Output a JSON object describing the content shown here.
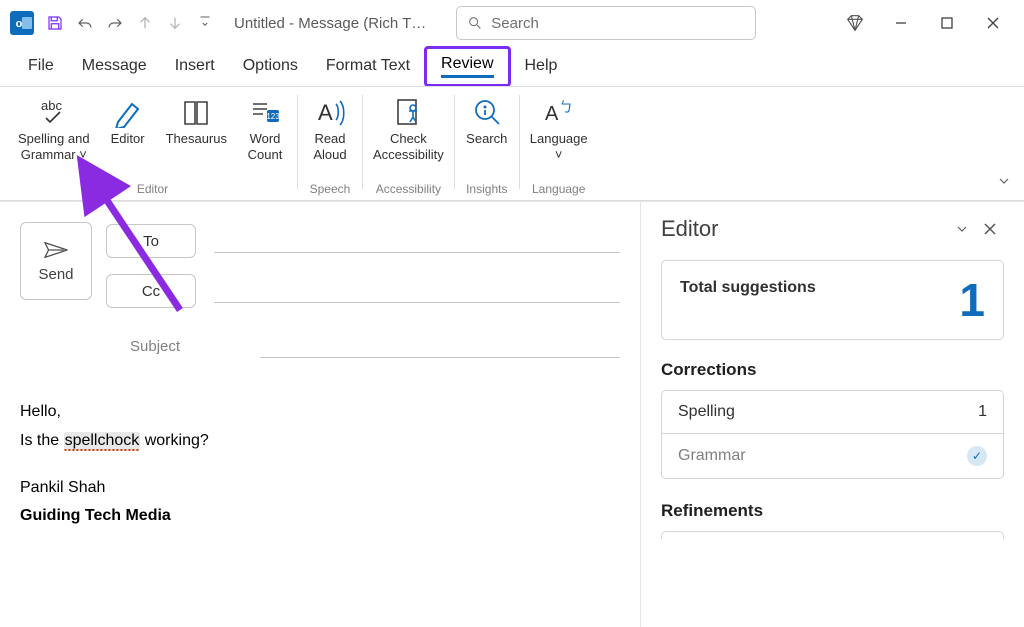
{
  "title": "Untitled - Message (Rich T…",
  "search_placeholder": "Search",
  "menu": [
    "File",
    "Message",
    "Insert",
    "Options",
    "Format Text",
    "Review",
    "Help"
  ],
  "active_menu_index": 5,
  "ribbon": {
    "groups": [
      {
        "label": "Editor",
        "buttons": [
          {
            "label": "Spelling and\nGrammar ˅",
            "icon": "abc-check"
          },
          {
            "label": "Editor",
            "icon": "pen"
          },
          {
            "label": "Thesaurus",
            "icon": "book"
          },
          {
            "label": "Word\nCount",
            "icon": "count"
          }
        ]
      },
      {
        "label": "Speech",
        "buttons": [
          {
            "label": "Read\nAloud",
            "icon": "read-aloud"
          }
        ]
      },
      {
        "label": "Accessibility",
        "buttons": [
          {
            "label": "Check\nAccessibility",
            "icon": "accessibility"
          }
        ]
      },
      {
        "label": "Insights",
        "buttons": [
          {
            "label": "Search",
            "icon": "insight-search"
          }
        ]
      },
      {
        "label": "Language",
        "buttons": [
          {
            "label": "Language\n˅",
            "icon": "language"
          }
        ]
      }
    ]
  },
  "compose": {
    "send": "Send",
    "to": "To",
    "cc": "Cc",
    "subject_label": "Subject",
    "body_line1": "Hello,",
    "body_line2_pre": "Is the ",
    "body_line2_err": "spellchock",
    "body_line2_post": " working?",
    "sig1": "Pankil Shah",
    "sig2": "Guiding Tech Media"
  },
  "editor_pane": {
    "title": "Editor",
    "total_label": "Total suggestions",
    "total_count": "1",
    "corrections_title": "Corrections",
    "spelling_label": "Spelling",
    "spelling_count": "1",
    "grammar_label": "Grammar",
    "refinements_title": "Refinements"
  }
}
